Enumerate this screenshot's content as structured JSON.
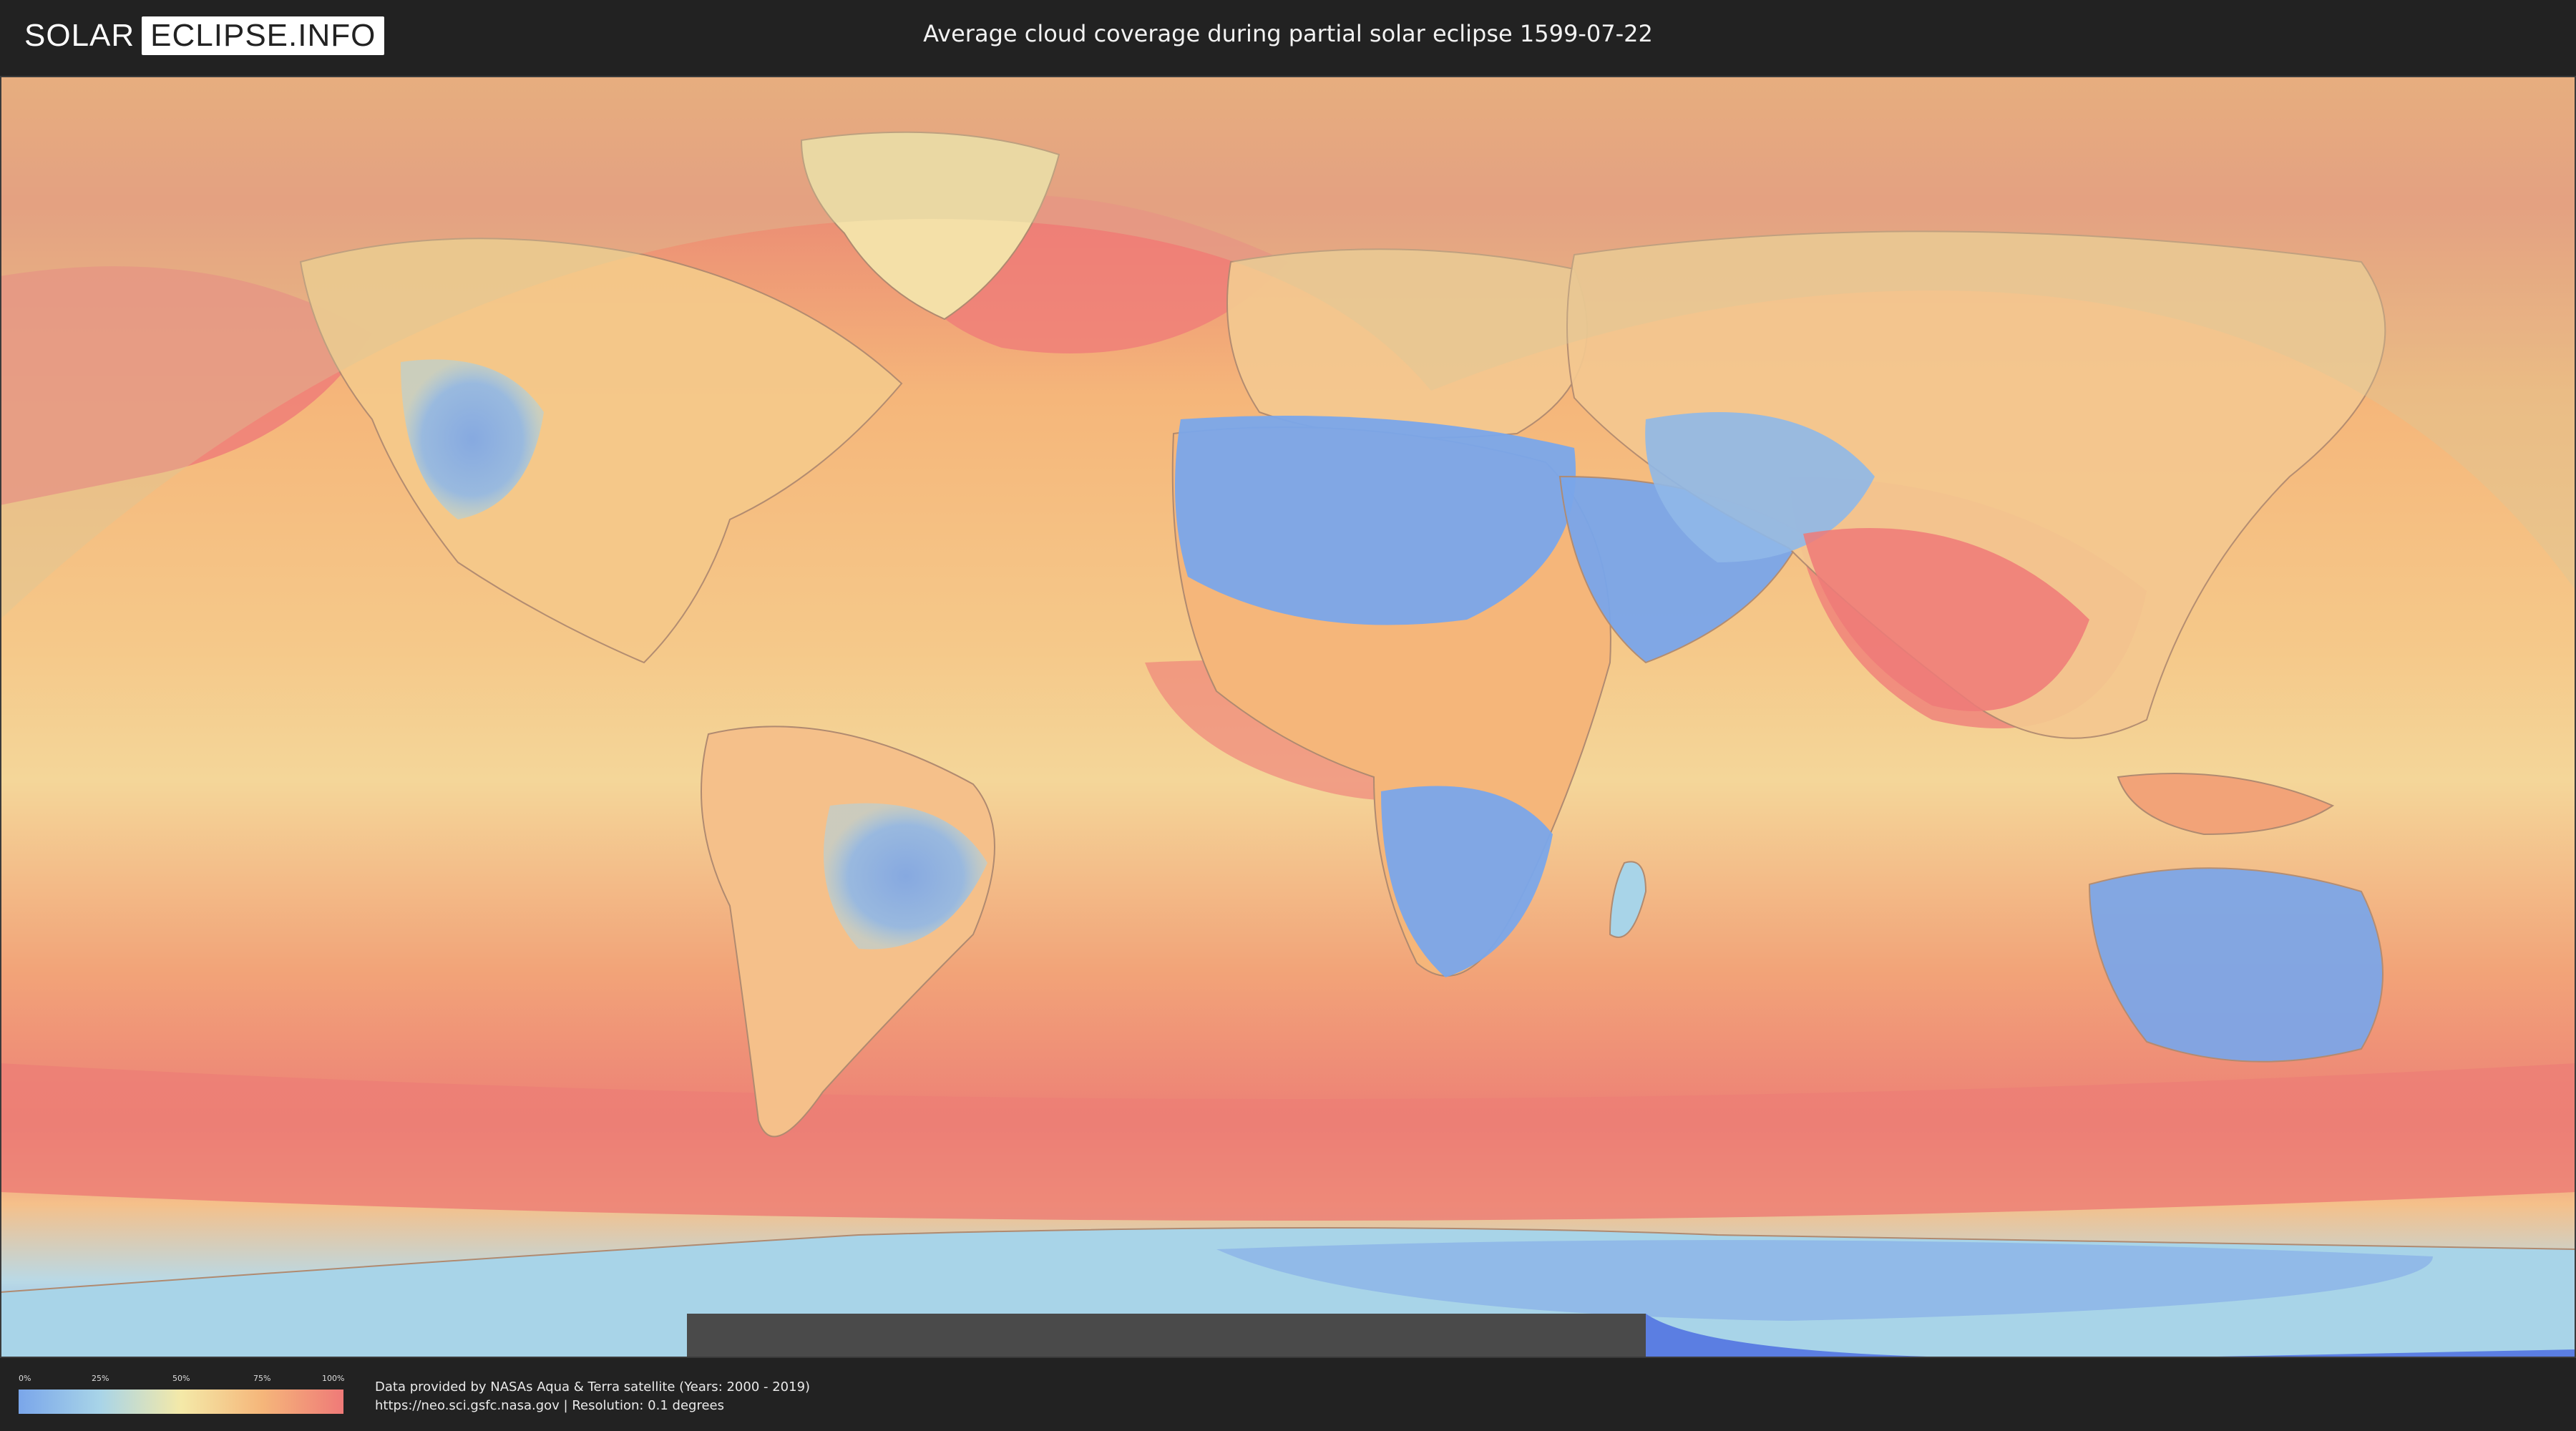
{
  "header": {
    "logo_left": "SOLAR",
    "logo_right": "ECLIPSE.INFO",
    "title": "Average cloud coverage during partial solar eclipse 1599-07-22"
  },
  "map": {
    "colors": {
      "clear": "#7aa6ea",
      "low": "#a8d4e8",
      "mid": "#f4e9a8",
      "high": "#f5b67a",
      "overcast": "#ef7a78",
      "no_data": "#4a4a4a",
      "eclipse_shade": "#d8c89a"
    }
  },
  "legend": {
    "ticks": [
      "0%",
      "25%",
      "50%",
      "75%",
      "100%"
    ]
  },
  "credits": {
    "line1": "Data provided by NASAs Aqua & Terra satellite (Years: 2000 - 2019)",
    "line2": "https://neo.sci.gsfc.nasa.gov | Resolution: 0.1 degrees"
  }
}
